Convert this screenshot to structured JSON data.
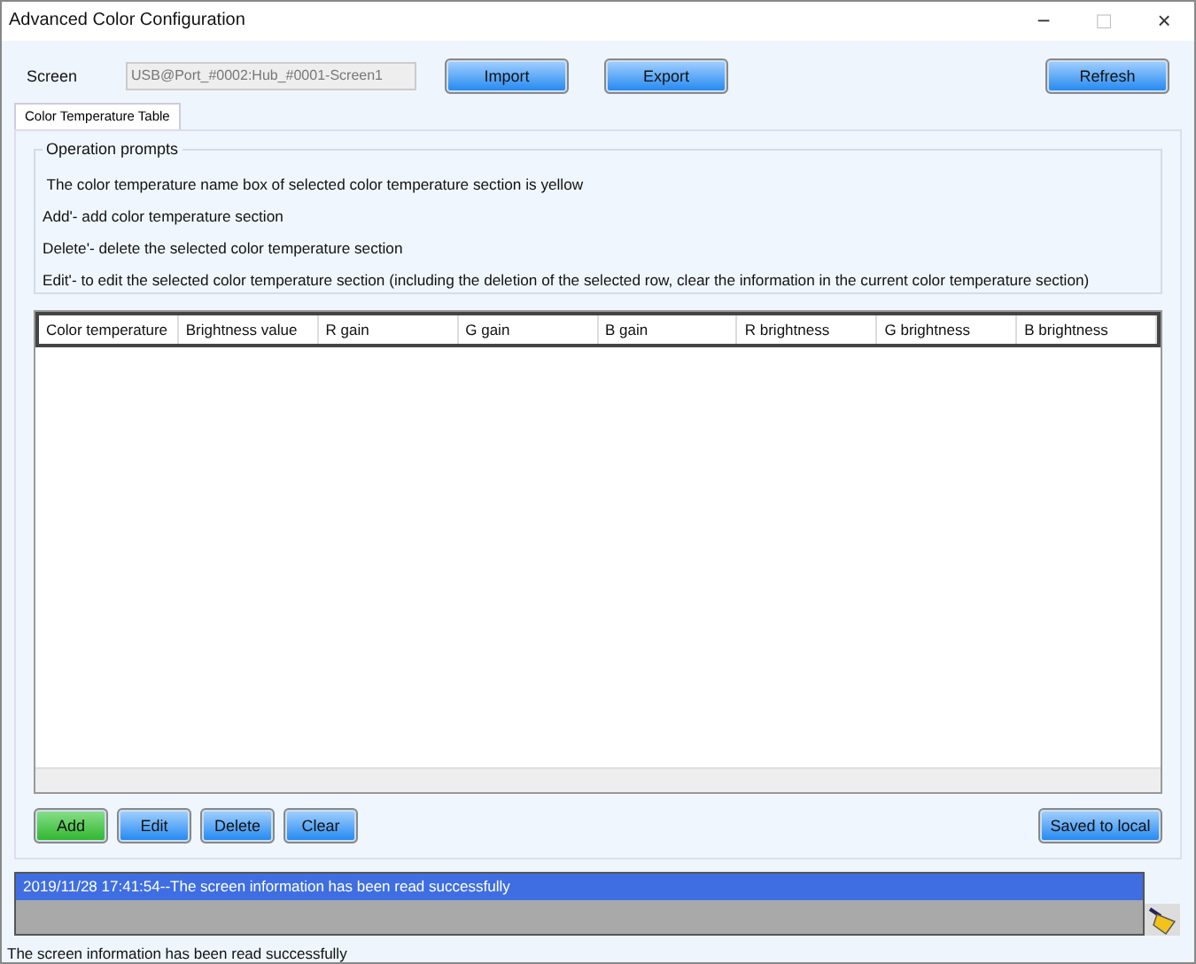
{
  "window": {
    "title": "Advanced Color Configuration",
    "controls": [
      "−",
      "□",
      "×"
    ]
  },
  "screen": {
    "label": "Screen",
    "value": "USB@Port_#0002:Hub_#0001-Screen1"
  },
  "top_buttons": [
    "Import",
    "Export"
  ],
  "refresh_button": "Refresh",
  "tabs": [
    {
      "label": "Color Temperature Table",
      "selected": true
    }
  ],
  "prompts": {
    "title": "Operation prompts",
    "lines": [
      " The color temperature name box of selected color temperature section is yellow",
      "Add'- add color temperature section",
      "Delete'- delete the selected color temperature section",
      "Edit'- to edit the selected color temperature section (including the deletion of the selected row, clear the information in the current color temperature section)"
    ]
  },
  "table": {
    "columns": [
      "Color temperature",
      "Brightness value",
      "R gain",
      "G gain",
      "B gain",
      "R brightness",
      "G brightness",
      "B brightness"
    ]
  },
  "bottom_buttons": [
    {
      "label": "Add",
      "kind": "green"
    },
    {
      "label": "Edit",
      "kind": "blue"
    },
    {
      "label": "Delete",
      "kind": "blue"
    },
    {
      "label": "Clear",
      "kind": "blue"
    }
  ],
  "save_button": "Saved to local",
  "log": [
    {
      "text": "2019/11/28 17:41:54--The screen information has been read successfully",
      "selected": true
    }
  ],
  "status_bar": "The screen information has been read successfully"
}
